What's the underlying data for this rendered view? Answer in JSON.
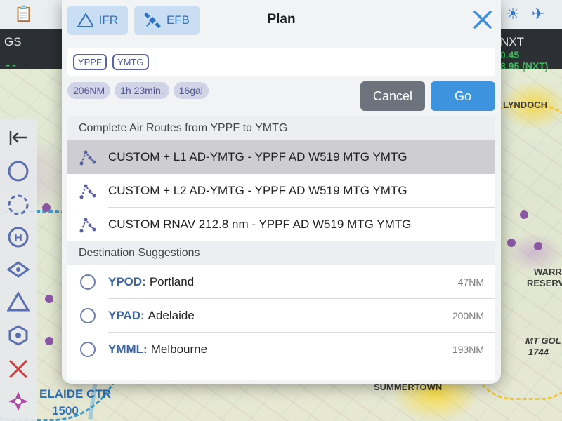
{
  "map": {
    "gs_label": "GS",
    "gs_value": "--",
    "nxt_label": "NXT",
    "nxt_value1": "0.45",
    "nxt_value2": "8.95 (NXT)",
    "places": [
      "LYNDOCH",
      "SUMMERTOWN",
      "ELAIDE CTR",
      "MT GOL",
      "RESERV",
      "WARR"
    ],
    "ctr_altitude": "1500",
    "spot_height": "1744"
  },
  "modal": {
    "title": "Plan",
    "tabs": [
      {
        "label": "IFR",
        "icon": "triangle-icon",
        "active": true
      },
      {
        "label": "EFB",
        "icon": "satellite-icon",
        "active": true
      }
    ],
    "route_input": {
      "chips": [
        "YPPF",
        "YMTG"
      ]
    },
    "summary": {
      "distance": "206NM",
      "time": "1h 23min.",
      "fuel": "16gal"
    },
    "cancel_label": "Cancel",
    "go_label": "Go",
    "routes_header": "Complete Air Routes from YPPF to YMTG",
    "routes": [
      {
        "label": "CUSTOM + L1 AD-YMTG - YPPF  AD W519 MTG YMTG",
        "selected": true
      },
      {
        "label": "CUSTOM + L2 AD-YMTG - YPPF  AD W519 MTG YMTG",
        "selected": false
      },
      {
        "label": "CUSTOM RNAV 212.8 nm - YPPF AD W519 MTG YMTG",
        "selected": false
      }
    ],
    "destinations_header": "Destination Suggestions",
    "destinations": [
      {
        "code": "YPOD:",
        "name": "Portland",
        "distance": "47NM"
      },
      {
        "code": "YPAD:",
        "name": "Adelaide",
        "distance": "200NM"
      },
      {
        "code": "YMML:",
        "name": "Melbourne",
        "distance": "193NM"
      }
    ]
  },
  "colors": {
    "accent": "#3d93dd",
    "chip": "#5c63a6",
    "selected_row": "#cdcdd2",
    "cancel": "#6d737c"
  }
}
